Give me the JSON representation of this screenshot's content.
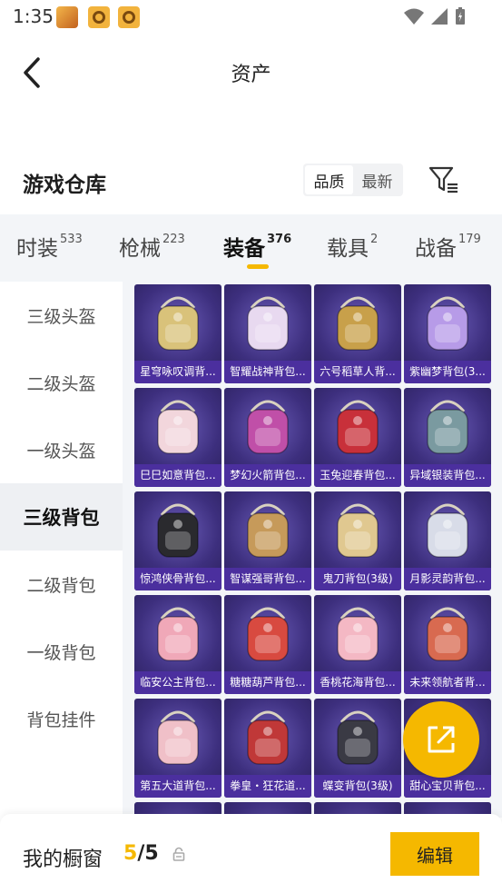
{
  "status_bar": {
    "time": "1:35"
  },
  "header": {
    "title": "资产"
  },
  "warehouse": {
    "title": "游戏仓库",
    "sort_options": [
      "品质",
      "最新"
    ],
    "sort_selected": "品质"
  },
  "tabs": [
    {
      "label": "时装",
      "count": "533"
    },
    {
      "label": "枪械",
      "count": "223"
    },
    {
      "label": "装备",
      "count": "376",
      "active": true
    },
    {
      "label": "载具",
      "count": "2"
    },
    {
      "label": "战备",
      "count": "179"
    }
  ],
  "sidebar": {
    "items": [
      {
        "label": "三级头盔"
      },
      {
        "label": "二级头盔"
      },
      {
        "label": "一级头盔"
      },
      {
        "label": "三级背包",
        "active": true
      },
      {
        "label": "二级背包"
      },
      {
        "label": "一级背包"
      },
      {
        "label": "背包挂件"
      }
    ]
  },
  "items": [
    {
      "name": "星穹咏叹调背...",
      "color": "#d9c27a"
    },
    {
      "name": "智耀战神背包...",
      "color": "#e8d9f0"
    },
    {
      "name": "六号稻草人背...",
      "color": "#c8a04a"
    },
    {
      "name": "紫幽梦背包(3...",
      "color": "#b79be8"
    },
    {
      "name": "巳巳如意背包...",
      "color": "#f2d6dc"
    },
    {
      "name": "梦幻火箭背包...",
      "color": "#c04fa8"
    },
    {
      "name": "玉兔迎春背包...",
      "color": "#c8303a"
    },
    {
      "name": "异域银装背包...",
      "color": "#7a9aa0"
    },
    {
      "name": "惊鸿侠骨背包...",
      "color": "#2a2a2e"
    },
    {
      "name": "智谋强哥背包...",
      "color": "#c69a5a"
    },
    {
      "name": "鬼刀背包(3级)",
      "color": "#e0c890"
    },
    {
      "name": "月影灵韵背包...",
      "color": "#d8dce8"
    },
    {
      "name": "临安公主背包...",
      "color": "#f0a8b8"
    },
    {
      "name": "糖糖葫芦背包...",
      "color": "#d84a40"
    },
    {
      "name": "香桃花海背包...",
      "color": "#f4b8c4"
    },
    {
      "name": "未来领航者背...",
      "color": "#d86a50"
    },
    {
      "name": "第五大道背包...",
      "color": "#f0c0c8"
    },
    {
      "name": "拳皇・狂花道...",
      "color": "#c03838"
    },
    {
      "name": "蝶变背包(3级)",
      "color": "#3a3a44"
    },
    {
      "name": "甜心宝贝背包...",
      "color": "#e8a0b0"
    },
    {
      "name": "",
      "color": "#3a2a6a"
    },
    {
      "name": "",
      "color": "#3a2a6a"
    },
    {
      "name": "",
      "color": "#3a2a6a"
    },
    {
      "name": "",
      "color": "#3a2a6a"
    }
  ],
  "bottom_bar": {
    "label": "我的橱窗",
    "count_current": "5",
    "count_sep": "/",
    "count_total": "5",
    "edit_label": "编辑"
  },
  "icons": {
    "back": "back-arrow-icon",
    "filter": "filter-icon",
    "share": "share-icon",
    "lock": "lock-icon"
  },
  "colors": {
    "accent": "#f5b800",
    "card_label_bg": "#4b2f9e"
  }
}
